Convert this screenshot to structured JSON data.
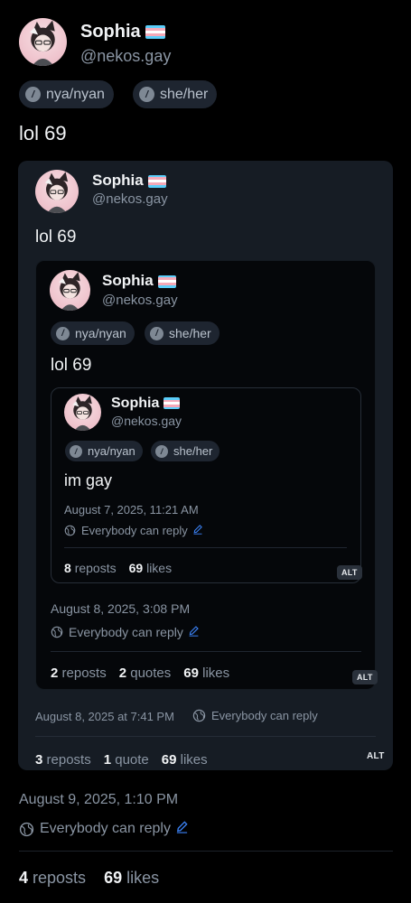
{
  "post": {
    "author": {
      "name": "Sophia",
      "handle": "@nekos.gay"
    },
    "pronouns": [
      "nya/nyan",
      "she/her"
    ],
    "text": "lol 69",
    "timestamp": "August 9, 2025, 1:10 PM",
    "reply_setting": "Everybody can reply",
    "reposts_count": "4",
    "reposts_label": "reposts",
    "likes_count": "69",
    "likes_label": "likes"
  },
  "quote1": {
    "author": {
      "name": "Sophia",
      "handle": "@nekos.gay"
    },
    "text": "lol 69",
    "timestamp": "August 8, 2025 at 7:41 PM",
    "reply_setting": "Everybody can reply",
    "reposts_count": "3",
    "reposts_label": "reposts",
    "quotes_count": "1",
    "quotes_label": "quote",
    "likes_count": "69",
    "likes_label": "likes",
    "alt_label": "ALT"
  },
  "quote2": {
    "author": {
      "name": "Sophia",
      "handle": "@nekos.gay"
    },
    "pronouns": [
      "nya/nyan",
      "she/her"
    ],
    "text": "lol 69",
    "timestamp": "August 8, 2025, 3:08 PM",
    "reply_setting": "Everybody can reply",
    "reposts_count": "2",
    "reposts_label": "reposts",
    "quotes_count": "2",
    "quotes_label": "quotes",
    "likes_count": "69",
    "likes_label": "likes",
    "alt_label": "ALT"
  },
  "quote3": {
    "author": {
      "name": "Sophia",
      "handle": "@nekos.gay"
    },
    "pronouns": [
      "nya/nyan",
      "she/her"
    ],
    "text": "im gay",
    "timestamp": "August 7, 2025, 11:21 AM",
    "reply_setting": "Everybody can reply",
    "reposts_count": "8",
    "reposts_label": "reposts",
    "likes_count": "69",
    "likes_label": "likes",
    "alt_label": "ALT"
  },
  "colors": {
    "background": "#000000",
    "card": "#161c24",
    "accent_link": "#3b82f6",
    "muted_text": "#8a95a3",
    "flag_blue": "#5bcefa",
    "flag_pink": "#f5a9b8",
    "flag_white": "#ffffff"
  },
  "icons": {
    "pronoun": "slash-circle-icon",
    "reply": "globe-icon",
    "edit": "pencil-icon"
  }
}
